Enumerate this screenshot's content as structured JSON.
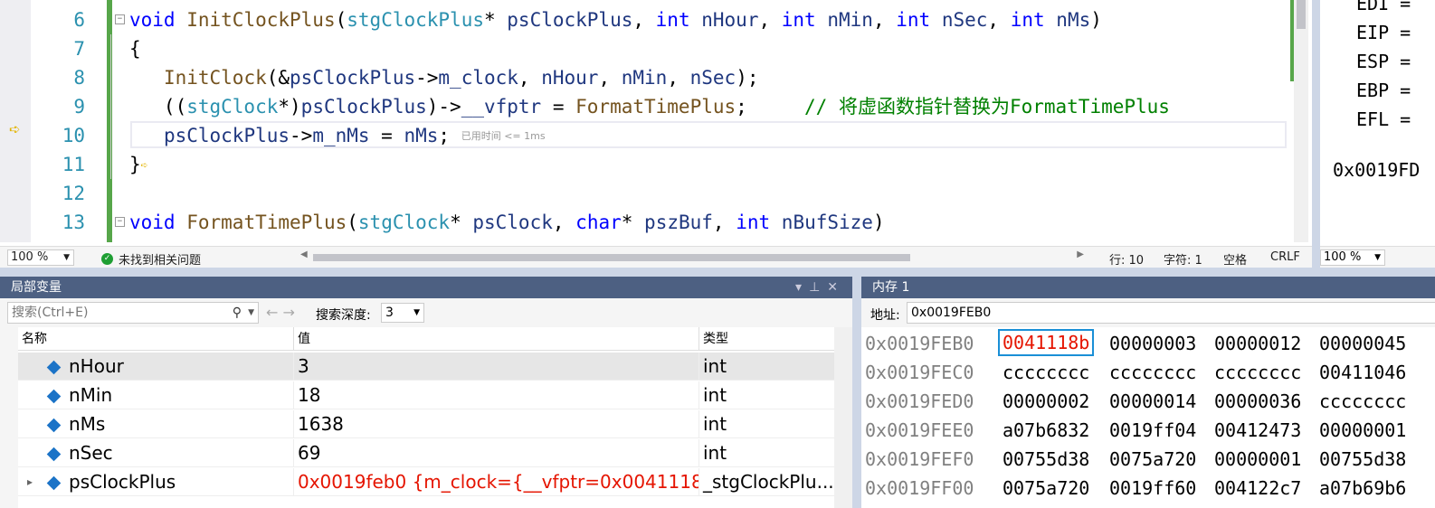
{
  "editor": {
    "lines": [
      {
        "num": "6",
        "tokens": [
          [
            "kw",
            "void"
          ],
          [
            "pl",
            " "
          ],
          [
            "fn",
            "InitClockPlus"
          ],
          [
            "pl",
            "("
          ],
          [
            "ty",
            "stgClockPlus"
          ],
          [
            "pl",
            "* "
          ],
          [
            "va",
            "psClockPlus"
          ],
          [
            "pl",
            ", "
          ],
          [
            "kw",
            "int"
          ],
          [
            "pl",
            " "
          ],
          [
            "va",
            "nHour"
          ],
          [
            "pl",
            ", "
          ],
          [
            "kw",
            "int"
          ],
          [
            "pl",
            " "
          ],
          [
            "va",
            "nMin"
          ],
          [
            "pl",
            ", "
          ],
          [
            "kw",
            "int"
          ],
          [
            "pl",
            " "
          ],
          [
            "va",
            "nSec"
          ],
          [
            "pl",
            ", "
          ],
          [
            "kw",
            "int"
          ],
          [
            "pl",
            " "
          ],
          [
            "va",
            "nMs"
          ],
          [
            "pl",
            ")"
          ]
        ]
      },
      {
        "num": "7",
        "tokens": [
          [
            "pl",
            "{"
          ]
        ]
      },
      {
        "num": "8",
        "tokens": [
          [
            "pl",
            "   "
          ],
          [
            "fn",
            "InitClock"
          ],
          [
            "pl",
            "(&"
          ],
          [
            "va",
            "psClockPlus"
          ],
          [
            "pl",
            "->"
          ],
          [
            "va",
            "m_clock"
          ],
          [
            "pl",
            ", "
          ],
          [
            "va",
            "nHour"
          ],
          [
            "pl",
            ", "
          ],
          [
            "va",
            "nMin"
          ],
          [
            "pl",
            ", "
          ],
          [
            "va",
            "nSec"
          ],
          [
            "pl",
            ");"
          ]
        ]
      },
      {
        "num": "9",
        "tokens": [
          [
            "pl",
            "   (("
          ],
          [
            "ty",
            "stgClock"
          ],
          [
            "pl",
            "*)"
          ],
          [
            "va",
            "psClockPlus"
          ],
          [
            "pl",
            ")->"
          ],
          [
            "va",
            "__vfptr"
          ],
          [
            "pl",
            " = "
          ],
          [
            "fn",
            "FormatTimePlus"
          ],
          [
            "pl",
            ";     "
          ],
          [
            "cm",
            "// 将虚函数指针替换为FormatTimePlus"
          ]
        ]
      },
      {
        "num": "10",
        "tokens": [
          [
            "pl",
            "   "
          ],
          [
            "va",
            "psClockPlus"
          ],
          [
            "pl",
            "->"
          ],
          [
            "va",
            "m_nMs"
          ],
          [
            "pl",
            " = "
          ],
          [
            "va",
            "nMs"
          ],
          [
            "pl",
            "; "
          ]
        ],
        "hint": "已用时间 <= 1ms"
      },
      {
        "num": "11",
        "tokens": [
          [
            "pl",
            "}"
          ]
        ]
      },
      {
        "num": "12",
        "tokens": []
      },
      {
        "num": "13",
        "tokens": [
          [
            "kw",
            "void"
          ],
          [
            "pl",
            " "
          ],
          [
            "fn",
            "FormatTimePlus"
          ],
          [
            "pl",
            "("
          ],
          [
            "ty",
            "stgClock"
          ],
          [
            "pl",
            "* "
          ],
          [
            "va",
            "psClock"
          ],
          [
            "pl",
            ", "
          ],
          [
            "kw",
            "char"
          ],
          [
            "pl",
            "* "
          ],
          [
            "va",
            "pszBuf"
          ],
          [
            "pl",
            ", "
          ],
          [
            "kw",
            "int"
          ],
          [
            "pl",
            " "
          ],
          [
            "va",
            "nBufSize"
          ],
          [
            "pl",
            ")"
          ]
        ]
      }
    ],
    "status": {
      "zoom": "100 %",
      "issues": "未找到相关问题",
      "line": "行: 10",
      "char": "字符: 1",
      "spaces": "空格",
      "eol": "CRLF"
    }
  },
  "registers": {
    "lines": [
      "EDI =",
      "EIP =",
      "ESP =",
      "EBP =",
      "EFL =",
      "",
      "0x0019FD"
    ],
    "zoom": "100 %"
  },
  "locals": {
    "title": "局部变量",
    "search_placeholder": "搜索(Ctrl+E)",
    "depth_label": "搜索深度:",
    "depth_value": "3",
    "columns": [
      "名称",
      "值",
      "类型"
    ],
    "rows": [
      {
        "name": "nHour",
        "value": "3",
        "type": "int"
      },
      {
        "name": "nMin",
        "value": "18",
        "type": "int"
      },
      {
        "name": "nMs",
        "value": "1638",
        "type": "int"
      },
      {
        "name": "nSec",
        "value": "69",
        "type": "int"
      },
      {
        "name": "psClockPlus",
        "value": "0x0019feb0 {m_clock={__vfptr=0x0041118...",
        "type": "_stgClockPlu..."
      }
    ]
  },
  "memory": {
    "title": "内存 1",
    "addr_label": "地址:",
    "addr_value": "0x0019FEB0",
    "rows": [
      {
        "addr": "0x0019FEB0",
        "cells": [
          "0041118b",
          "00000003",
          "00000012",
          "00000045"
        ]
      },
      {
        "addr": "0x0019FEC0",
        "cells": [
          "cccccccc",
          "cccccccc",
          "cccccccc",
          "00411046"
        ]
      },
      {
        "addr": "0x0019FED0",
        "cells": [
          "00000002",
          "00000014",
          "00000036",
          "cccccccc"
        ]
      },
      {
        "addr": "0x0019FEE0",
        "cells": [
          "a07b6832",
          "0019ff04",
          "00412473",
          "00000001"
        ]
      },
      {
        "addr": "0x0019FEF0",
        "cells": [
          "00755d38",
          "0075a720",
          "00000001",
          "00755d38"
        ]
      },
      {
        "addr": "0x0019FF00",
        "cells": [
          "0075a720",
          "0019ff60",
          "004122c7",
          "a07b69b6"
        ]
      }
    ]
  }
}
